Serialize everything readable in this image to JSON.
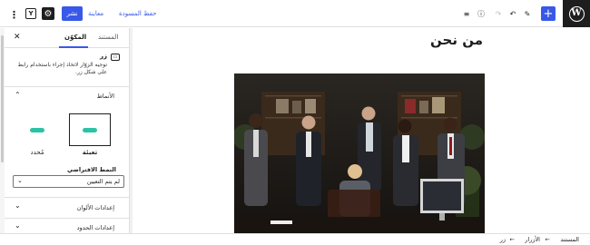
{
  "app": {
    "logo_glyph": "W"
  },
  "toolbar": {
    "add_label": "+",
    "publish_label": "نشر",
    "preview_label": "معاينة",
    "save_draft_label": "حفظ المسودة",
    "undo_glyph": "↶",
    "redo_glyph": "↷",
    "tools_glyph": "✎",
    "info_glyph": "ⓘ",
    "list_view_glyph": "≡",
    "settings_glyph": "⚙",
    "yoast_glyph": "Y",
    "more_glyph": "⋮",
    "accent_color": "#3858e9"
  },
  "editor": {
    "page_title": "من نحن"
  },
  "sidebar": {
    "close_glyph": "✕",
    "tabs": [
      {
        "label": "المكوّن",
        "active": true
      },
      {
        "label": "المستند",
        "active": false
      }
    ],
    "block": {
      "icon_glyph": "▭",
      "name": "زر",
      "description": "توجيه الزوّار لاتخاذ إجراء باستخدام رابط على شكل زر."
    },
    "styles_panel": {
      "title": "الأنماط",
      "options": [
        {
          "label": "تعبئة",
          "active": true
        },
        {
          "label": "مُحدد",
          "active": false
        }
      ]
    },
    "default_style": {
      "label": "النمط الافتراضي",
      "value": "لم يتم التعيين"
    },
    "color_panel": {
      "title": "إعدادات الألوان"
    },
    "border_panel": {
      "title": "إعدادات الحدود"
    },
    "pill_color": "#2bc3a5"
  },
  "breadcrumb": {
    "items": [
      "المستند",
      "الأزرار",
      "زر"
    ],
    "separator": "←"
  }
}
